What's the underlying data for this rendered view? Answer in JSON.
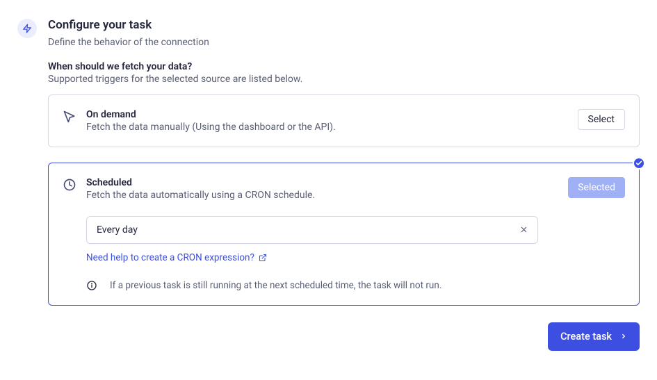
{
  "header": {
    "title": "Configure your task",
    "subtitle": "Define the behavior of the connection"
  },
  "section": {
    "title": "When should we fetch your data?",
    "desc": "Supported triggers for the selected source are listed below."
  },
  "onDemand": {
    "title": "On demand",
    "desc": "Fetch the data manually (Using the dashboard or the API).",
    "buttonLabel": "Select"
  },
  "scheduled": {
    "title": "Scheduled",
    "desc": "Fetch the data automatically using a CRON schedule.",
    "buttonLabel": "Selected",
    "cronValue": "Every day",
    "helpLink": "Need help to create a CRON expression?",
    "infoNote": "If a previous task is still running at the next scheduled time, the task will not run."
  },
  "footer": {
    "createButton": "Create task"
  }
}
